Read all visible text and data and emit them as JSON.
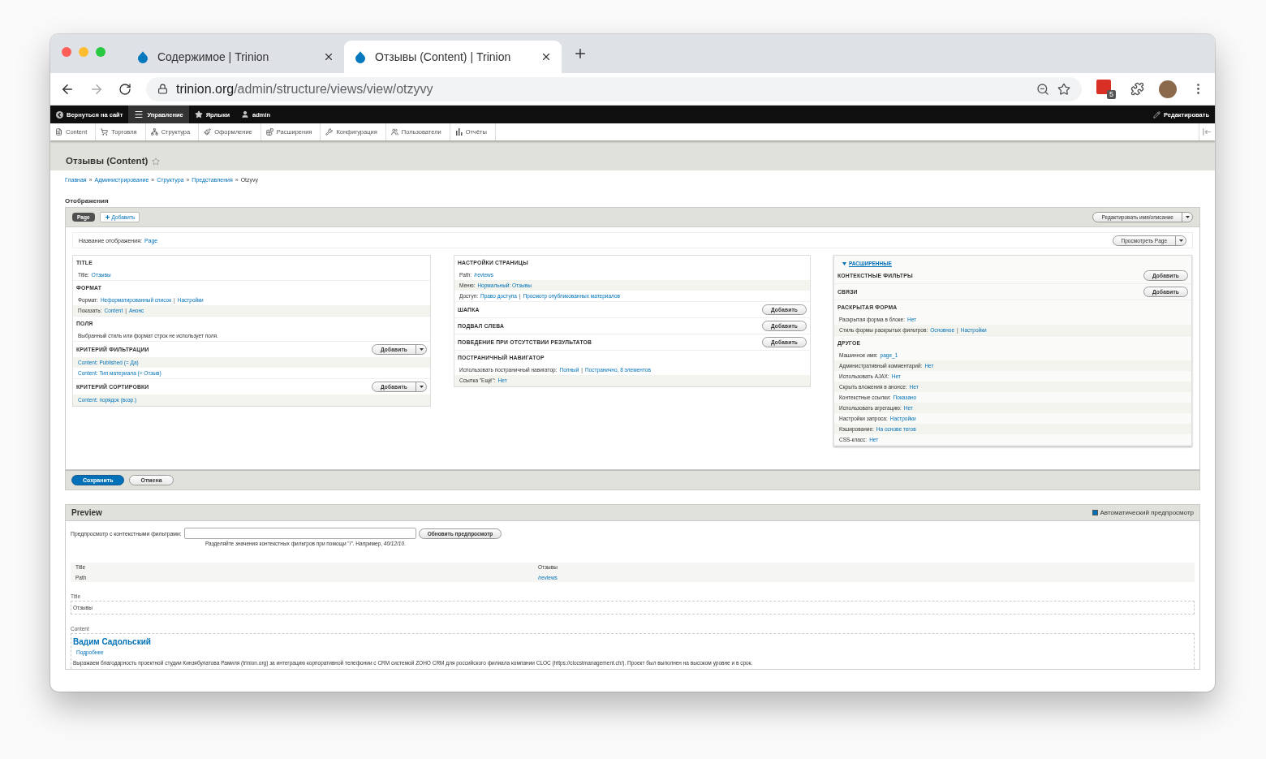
{
  "browser": {
    "tabs": [
      {
        "title": "Содержимое | Trinion",
        "selected": false
      },
      {
        "title": "Отзывы (Content) | Trinion",
        "selected": true
      }
    ],
    "url_host": "trinion.org",
    "url_path": "/admin/structure/views/view/otzyvy",
    "extension_badge": "5"
  },
  "admin_toolbar": {
    "items": [
      {
        "label": "Вернуться на сайт",
        "kind": "back",
        "selected": false
      },
      {
        "label": "Управление",
        "kind": "menu",
        "selected": true
      },
      {
        "label": "Ярлыки",
        "kind": "star",
        "selected": false
      },
      {
        "label": "admin",
        "kind": "user",
        "selected": false
      }
    ],
    "edit": "Редактировать"
  },
  "tray": [
    {
      "label": "Content",
      "kind": "content"
    },
    {
      "label": "Торговля",
      "kind": "shop"
    },
    {
      "label": "Структура",
      "kind": "structure"
    },
    {
      "label": "Оформление",
      "kind": "appearance"
    },
    {
      "label": "Расширения",
      "kind": "extend"
    },
    {
      "label": "Конфигурация",
      "kind": "config"
    },
    {
      "label": "Пользователи",
      "kind": "people"
    },
    {
      "label": "Отчёты",
      "kind": "reports"
    }
  ],
  "page_title": "Отзывы (Content)",
  "breadcrumbs": [
    "Главная",
    "Администрирование",
    "Структура",
    "Представления"
  ],
  "breadcrumb_current": "Otzyvy",
  "breadcrumb_separator": "»",
  "link_separator": "|",
  "displays_label": "Отображения",
  "display_tabs": [
    {
      "label": "Page",
      "selected": true
    }
  ],
  "add_display": "Добавить",
  "edit_name_button": "Редактировать имя/описание",
  "display_name": {
    "label": "Название отображения:",
    "value": "Page"
  },
  "view_button": "Просмотреть Page",
  "columns": [
    {
      "sections": [
        {
          "title": "TITLE",
          "rows": [
            {
              "label": "Title:",
              "links": [
                "Отзывы"
              ],
              "striped": false
            }
          ]
        },
        {
          "title": "ФОРМАТ",
          "rows": [
            {
              "label": "Формат:",
              "links": [
                "Неформатированный список",
                "Настройки"
              ],
              "striped": false
            },
            {
              "label": "Показать:",
              "links": [
                "Content",
                "Анонс"
              ],
              "striped": true
            }
          ]
        },
        {
          "title": "ПОЛЯ",
          "rows": [
            {
              "label": "Выбранный стиль или формат строк не использует поля.",
              "striped": false
            }
          ]
        },
        {
          "title": "КРИТЕРИЙ ФИЛЬТРАЦИИ",
          "button": {
            "label": "Добавить",
            "dropdown": true
          },
          "rows": [
            {
              "links": [
                "Content: Published (= Да)"
              ],
              "striped": true
            },
            {
              "links": [
                "Content: Тип материала (= Отзыв)"
              ],
              "striped": false
            }
          ]
        },
        {
          "title": "КРИТЕРИЙ СОРТИРОВКИ",
          "button": {
            "label": "Добавить",
            "dropdown": true
          },
          "rows": [
            {
              "links": [
                "Content: порядок (возр.)"
              ],
              "striped": true
            }
          ]
        }
      ]
    },
    {
      "sections": [
        {
          "title": "НАСТРОЙКИ СТРАНИЦЫ",
          "rows": [
            {
              "label": "Path:",
              "links": [
                "/reviews"
              ],
              "striped": false
            },
            {
              "label": "Меню:",
              "links": [
                "Нормальный: Отзывы"
              ],
              "striped": true
            },
            {
              "label": "Доступ:",
              "links": [
                "Право доступа",
                "Просмотр опубликованных материалов"
              ],
              "striped": false
            }
          ]
        },
        {
          "title": "ШАПКА",
          "button": {
            "label": "Добавить",
            "dropdown": false
          }
        },
        {
          "title": "ПОДВАЛ СЛЕВА",
          "button": {
            "label": "Добавить",
            "dropdown": false
          }
        },
        {
          "title": "ПОВЕДЕНИЕ ПРИ ОТСУТСТВИИ РЕЗУЛЬТАТОВ",
          "button": {
            "label": "Добавить",
            "dropdown": false
          }
        },
        {
          "title": "ПОСТРАНИЧНЫЙ НАВИГАТОР",
          "rows": [
            {
              "label": "Использовать постраничный навигатор:",
              "links": [
                "Полный",
                "Постранично, 8 элементов"
              ],
              "striped": false
            },
            {
              "label": "Ссылка \"Ещё\":",
              "links": [
                "Нет"
              ],
              "striped": true
            }
          ]
        }
      ]
    },
    {
      "advanced": {
        "label": "РАСШИРЕННЫЕ",
        "expanded": true
      },
      "sections": [
        {
          "title": "КОНТЕКСТНЫЕ ФИЛЬТРЫ",
          "button": {
            "label": "Добавить",
            "dropdown": false
          }
        },
        {
          "title": "СВЯЗИ",
          "button": {
            "label": "Добавить",
            "dropdown": false
          }
        },
        {
          "title": "РАСКРЫТАЯ ФОРМА",
          "rows": [
            {
              "label": "Раскрытая форма в блоке:",
              "links": [
                "Нет"
              ],
              "striped": false
            },
            {
              "label": "Стиль формы раскрытых фильтров:",
              "links": [
                "Основное",
                "Настройки"
              ],
              "striped": true
            }
          ]
        },
        {
          "title": "ДРУГОЕ",
          "rows": [
            {
              "label": "Машинное имя:",
              "links": [
                "page_1"
              ],
              "striped": false
            },
            {
              "label": "Административный комментарий:",
              "links": [
                "Нет"
              ],
              "striped": true
            },
            {
              "label": "Использовать AJAX:",
              "links": [
                "Нет"
              ],
              "striped": false
            },
            {
              "label": "Скрыть вложения в анонсе:",
              "links": [
                "Нет"
              ],
              "striped": true
            },
            {
              "label": "Контекстные ссылки:",
              "links": [
                "Показано"
              ],
              "striped": false
            },
            {
              "label": "Использовать агрегацию:",
              "links": [
                "Нет"
              ],
              "striped": true
            },
            {
              "label": "Настройки запроса:",
              "links": [
                "Настройки"
              ],
              "striped": false
            },
            {
              "label": "Кэширование:",
              "links": [
                "На основе тегов"
              ],
              "striped": true
            },
            {
              "label": "CSS-класс:",
              "links": [
                "Нет"
              ],
              "striped": false
            }
          ]
        }
      ]
    }
  ],
  "actions": [
    {
      "label": "Сохранить",
      "kind": "primary"
    },
    {
      "label": "Отмена",
      "kind": "secondary"
    }
  ],
  "preview": {
    "title": "Preview",
    "auto": {
      "label": "Автоматический предпросмотр",
      "checked": true
    },
    "filter_label": "Предпросмотр с контекстными фильтрами:",
    "update_button": "Обновить предпросмотр",
    "hint": "Разделяйте значения контекстных фильтров при помощи \"/\". Например, *40/12/10*.",
    "info": [
      {
        "key": "Title",
        "value": "Отзывы",
        "link": false
      },
      {
        "key": "Path",
        "value": "/reviews",
        "link": true
      }
    ],
    "title_label": "Title",
    "title_value": "Отзывы",
    "content_label": "Content",
    "author": "Вадим Садольский",
    "more": "Подробнее",
    "body": "Выражаем благодарность проектной студии Кинзябулатова Рамиля (trinion.org) за интеграцию корпоративной телефонии с CRM системой ZOHO CRM для российского филиала компании CLOC (https://clocstmanagement.ch/). Проект был выполнен на высоком уровне и в срок."
  }
}
